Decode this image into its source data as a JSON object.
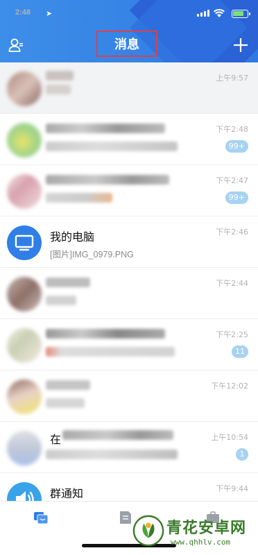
{
  "status_bar": {
    "time": "2:48"
  },
  "header": {
    "title": "消息"
  },
  "conversations": [
    {
      "time": "上午9:57"
    },
    {
      "time": "下午2:48",
      "badge": "99+"
    },
    {
      "time": "下午2:47",
      "badge": "99+"
    },
    {
      "name": "我的电脑",
      "preview": "[图片]IMG_0979.PNG",
      "time": "下午2:46"
    },
    {
      "time": "下午2:44"
    },
    {
      "time": "下午2:25",
      "badge": "11"
    },
    {
      "time": "下午12:02"
    },
    {
      "name_initial": "在",
      "time": "上午10:54",
      "badge": "1"
    },
    {
      "name": "群通知",
      "time": "下午9:44"
    }
  ],
  "watermark": {
    "text": "青花安卓网",
    "url": "www.qhhlv.com"
  },
  "colors": {
    "accent": "#2f79e2",
    "badge": "#a8d2f2",
    "highlight_box": "#d9424c"
  }
}
